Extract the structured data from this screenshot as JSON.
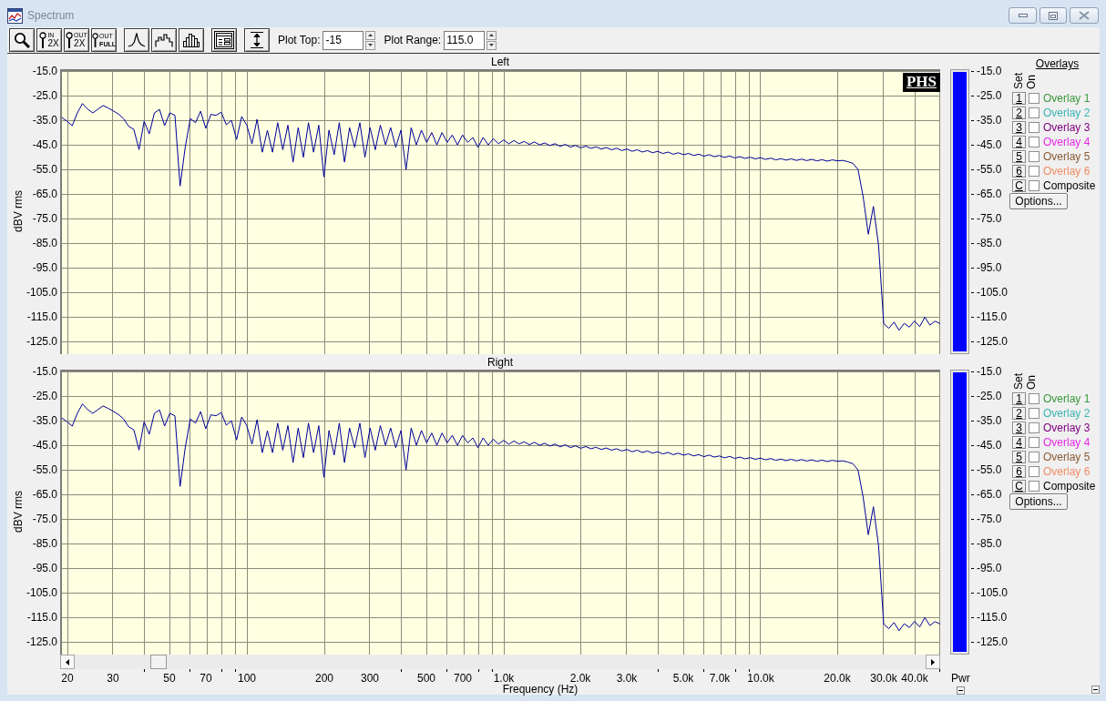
{
  "window": {
    "title": "Spectrum"
  },
  "toolbar": {
    "groups": [
      [
        {
          "kind": "magnifier"
        },
        {
          "kind": "captioned",
          "caption": [
            "IN",
            "2X"
          ]
        },
        {
          "kind": "captioned",
          "caption": [
            "OUT",
            "2X"
          ]
        },
        {
          "kind": "captioned",
          "caption": [
            "OUT",
            "FULL"
          ]
        }
      ],
      [
        {
          "kind": "peak"
        },
        {
          "kind": "steps"
        },
        {
          "kind": "bars"
        }
      ],
      [
        {
          "kind": "panel"
        }
      ],
      [
        {
          "kind": "range"
        }
      ]
    ],
    "fields": [
      {
        "label": "Plot Top:",
        "value": "-15"
      },
      {
        "label": "Plot Range:",
        "value": "115.0"
      }
    ]
  },
  "panels": [
    {
      "logo": "PHS",
      "chart_data": {
        "type": "line",
        "title": "Left",
        "ylabel": "dBV rms",
        "grid": true,
        "ylim": [
          -130,
          -15
        ],
        "yticks": [
          {
            "value": -15,
            "label": "-15.0"
          },
          {
            "value": -25,
            "label": "-25.0"
          },
          {
            "value": -35,
            "label": "-35.0"
          },
          {
            "value": -45,
            "label": "-45.0"
          },
          {
            "value": -55,
            "label": "-55.0"
          },
          {
            "value": -65,
            "label": "-65.0"
          },
          {
            "value": -75,
            "label": "-75.0"
          },
          {
            "value": -85,
            "label": "-85.0"
          },
          {
            "value": -95,
            "label": "-95.0"
          },
          {
            "value": -105,
            "label": "-105.0"
          },
          {
            "value": -115,
            "label": "-115.0"
          },
          {
            "value": -125,
            "label": "-125.0"
          }
        ],
        "values": [
          -33.9,
          -35.4,
          -37.2,
          -32,
          -28.2,
          -30.5,
          -32,
          -30.5,
          -29,
          -30,
          -31.2,
          -32.5,
          -34.3,
          -37.5,
          -38.7,
          -46.9,
          -35.4,
          -40.5,
          -32,
          -30.6,
          -37.2,
          -32,
          -33,
          -61.7,
          -46,
          -34.3,
          -36,
          -31.3,
          -38.3,
          -32.6,
          -33,
          -31.7,
          -36.8,
          -35,
          -42.8,
          -33.5,
          -37,
          -44.6,
          -34.6,
          -48,
          -39.1,
          -48,
          -36,
          -47,
          -37,
          -52,
          -38,
          -50,
          -36,
          -48,
          -37,
          -58,
          -39,
          -49,
          -36,
          -52,
          -38,
          -46,
          -36,
          -50,
          -38,
          -47,
          -37,
          -45,
          -38,
          -46,
          -39,
          -55,
          -38,
          -45,
          -39,
          -44,
          -40,
          -45,
          -40,
          -44,
          -41,
          -45,
          -41,
          -44,
          -42,
          -46,
          -42,
          -45,
          -42.5,
          -44.5,
          -43,
          -44.6,
          -43.2,
          -44.5,
          -43.6,
          -44.8,
          -43.8,
          -45,
          -44.2,
          -45.3,
          -44.5,
          -45.6,
          -44.8,
          -45.9,
          -45.2,
          -46.2,
          -45.5,
          -46.4,
          -45.8,
          -46.7,
          -46.1,
          -47,
          -46.4,
          -47.3,
          -46.7,
          -47.6,
          -47,
          -47.9,
          -47.3,
          -48.2,
          -47.6,
          -48.5,
          -47.9,
          -48.8,
          -48.2,
          -49,
          -48.5,
          -49.3,
          -48.8,
          -49.6,
          -49,
          -49.8,
          -49.3,
          -50.1,
          -49.5,
          -50.3,
          -49.8,
          -50.5,
          -50,
          -50.7,
          -50.2,
          -50.9,
          -50.4,
          -51.1,
          -50.6,
          -51.2,
          -50.7,
          -51.3,
          -50.8,
          -51.4,
          -50.9,
          -51.5,
          -51,
          -51.6,
          -51.1,
          -51.5,
          -51.3,
          -51.8,
          -52.5,
          -55,
          -66,
          -81.3,
          -70,
          -86,
          -117.6,
          -119.5,
          -117,
          -120.3,
          -117.5,
          -119,
          -116.5,
          -118.8,
          -115,
          -118.2,
          -116.6,
          -117.6
        ]
      },
      "meter": {
        "level": 1,
        "scale": [
          "-15.0",
          "-25.0",
          "-35.0",
          "-45.0",
          "-55.0",
          "-65.0",
          "-75.0",
          "-85.0",
          "-95.0",
          "-105.0",
          "-115.0",
          "-125.0"
        ]
      },
      "overlays": {
        "title": "Overlays",
        "headers": [
          "Set",
          "On"
        ],
        "rows": [
          {
            "set": "1",
            "checked": false,
            "label": "Overlay 1",
            "color": "#3a993a"
          },
          {
            "set": "2",
            "checked": false,
            "label": "Overlay 2",
            "color": "#3cb4b4"
          },
          {
            "set": "3",
            "checked": false,
            "label": "Overlay 3",
            "color": "#800080"
          },
          {
            "set": "4",
            "checked": false,
            "label": "Overlay 4",
            "color": "#e628e6"
          },
          {
            "set": "5",
            "checked": false,
            "label": "Overlay 5",
            "color": "#8c5a32"
          },
          {
            "set": "6",
            "checked": false,
            "label": "Overlay 6",
            "color": "#f08c64"
          },
          {
            "set": "C",
            "checked": false,
            "label": "Composite",
            "color": "#000000"
          }
        ],
        "options": "Options..."
      }
    },
    {
      "chart_data": {
        "type": "line",
        "title": "Right",
        "ylabel": "dBV rms",
        "xlabel": "Frequency (Hz)",
        "grid": true,
        "ylim": [
          -130,
          -15
        ],
        "yticks": [
          {
            "value": -15,
            "label": "-15.0"
          },
          {
            "value": -25,
            "label": "-25.0"
          },
          {
            "value": -35,
            "label": "-35.0"
          },
          {
            "value": -45,
            "label": "-45.0"
          },
          {
            "value": -55,
            "label": "-55.0"
          },
          {
            "value": -65,
            "label": "-65.0"
          },
          {
            "value": -75,
            "label": "-75.0"
          },
          {
            "value": -85,
            "label": "-85.0"
          },
          {
            "value": -95,
            "label": "-95.0"
          },
          {
            "value": -105,
            "label": "-105.0"
          },
          {
            "value": -115,
            "label": "-115.0"
          },
          {
            "value": -125,
            "label": "-125.0"
          }
        ],
        "categories": [
          null,
          "20",
          null,
          null,
          null,
          null,
          null,
          null,
          null,
          null,
          "30",
          null,
          null,
          null,
          null,
          null,
          null,
          null,
          null,
          null,
          null,
          "50",
          null,
          null,
          null,
          null,
          null,
          null,
          "70",
          null,
          null,
          null,
          null,
          null,
          null,
          null,
          "100",
          null,
          null,
          null,
          null,
          null,
          null,
          null,
          null,
          null,
          null,
          null,
          null,
          null,
          null,
          "200",
          null,
          null,
          null,
          null,
          null,
          null,
          null,
          null,
          "300",
          null,
          null,
          null,
          null,
          null,
          null,
          null,
          null,
          null,
          null,
          "500",
          null,
          null,
          null,
          null,
          null,
          null,
          "700",
          null,
          null,
          null,
          null,
          null,
          null,
          null,
          "1.0k",
          null,
          null,
          null,
          null,
          null,
          null,
          null,
          null,
          null,
          null,
          null,
          null,
          null,
          null,
          "2.0k",
          null,
          null,
          null,
          null,
          null,
          null,
          null,
          null,
          "3.0k",
          null,
          null,
          null,
          null,
          null,
          null,
          null,
          null,
          null,
          null,
          "5.0k",
          null,
          null,
          null,
          null,
          null,
          null,
          "7.0k",
          null,
          null,
          null,
          null,
          null,
          null,
          null,
          "10.0k",
          null,
          null,
          null,
          null,
          null,
          null,
          null,
          null,
          null,
          null,
          null,
          null,
          null,
          null,
          "20.0k",
          null,
          null,
          null,
          null,
          null,
          null,
          null,
          null,
          "30.0k",
          null,
          null,
          null,
          null,
          null,
          "40.0k",
          null,
          null,
          null,
          null,
          null
        ],
        "values": [
          -33.9,
          -35.4,
          -37.2,
          -32,
          -28.2,
          -30.5,
          -32,
          -30.5,
          -29,
          -30,
          -31.2,
          -32.5,
          -34.3,
          -37.5,
          -38.7,
          -46.9,
          -35.4,
          -40.5,
          -32,
          -30.6,
          -37.2,
          -32,
          -33,
          -61.7,
          -46,
          -34.3,
          -36,
          -31.3,
          -38.3,
          -32.6,
          -33,
          -31.7,
          -36.8,
          -35,
          -42.8,
          -33.5,
          -37,
          -44.6,
          -34.6,
          -48,
          -39.1,
          -48,
          -36,
          -47,
          -37,
          -52,
          -38,
          -50,
          -36,
          -48,
          -37,
          -58,
          -39,
          -49,
          -36,
          -52,
          -38,
          -46,
          -36,
          -50,
          -38,
          -47,
          -37,
          -45,
          -38,
          -46,
          -39,
          -55,
          -38,
          -45,
          -39,
          -44,
          -40,
          -45,
          -40,
          -44,
          -41,
          -45,
          -41,
          -44,
          -42,
          -46,
          -42,
          -45,
          -42.5,
          -44.5,
          -43,
          -44.6,
          -43.2,
          -44.5,
          -43.6,
          -44.8,
          -43.8,
          -45,
          -44.2,
          -45.3,
          -44.5,
          -45.6,
          -44.8,
          -45.9,
          -45.2,
          -46.2,
          -45.5,
          -46.4,
          -45.8,
          -46.7,
          -46.1,
          -47,
          -46.4,
          -47.3,
          -46.7,
          -47.6,
          -47,
          -47.9,
          -47.3,
          -48.2,
          -47.6,
          -48.5,
          -47.9,
          -48.8,
          -48.2,
          -49,
          -48.5,
          -49.3,
          -48.8,
          -49.6,
          -49,
          -49.8,
          -49.3,
          -50.1,
          -49.5,
          -50.3,
          -49.8,
          -50.5,
          -50,
          -50.7,
          -50.2,
          -50.9,
          -50.4,
          -51.1,
          -50.6,
          -51.2,
          -50.7,
          -51.3,
          -50.8,
          -51.4,
          -50.9,
          -51.5,
          -51,
          -51.6,
          -51.1,
          -51.5,
          -51.3,
          -51.8,
          -52.5,
          -55,
          -66,
          -81.3,
          -70,
          -86,
          -117.6,
          -119.5,
          -117,
          -120.3,
          -117.5,
          -119,
          -116.5,
          -118.8,
          -115,
          -118.2,
          -116.6,
          -117.6
        ]
      },
      "meter": {
        "level": 1,
        "label": "Pwr",
        "scale": [
          "-15.0",
          "-25.0",
          "-35.0",
          "-45.0",
          "-55.0",
          "-65.0",
          "-75.0",
          "-85.0",
          "-95.0",
          "-105.0",
          "-115.0",
          "-125.0"
        ]
      },
      "overlays": {
        "headers": [
          "Set",
          "On"
        ],
        "rows": [
          {
            "set": "1",
            "checked": false,
            "label": "Overlay 1",
            "color": "#3a993a"
          },
          {
            "set": "2",
            "checked": false,
            "label": "Overlay 2",
            "color": "#3cb4b4"
          },
          {
            "set": "3",
            "checked": false,
            "label": "Overlay 3",
            "color": "#800080"
          },
          {
            "set": "4",
            "checked": false,
            "label": "Overlay 4",
            "color": "#e628e6"
          },
          {
            "set": "5",
            "checked": false,
            "label": "Overlay 5",
            "color": "#8c5a32"
          },
          {
            "set": "6",
            "checked": false,
            "label": "Overlay 6",
            "color": "#f08c64"
          },
          {
            "set": "C",
            "checked": false,
            "label": "Composite",
            "color": "#000000"
          }
        ],
        "options": "Options..."
      }
    }
  ]
}
